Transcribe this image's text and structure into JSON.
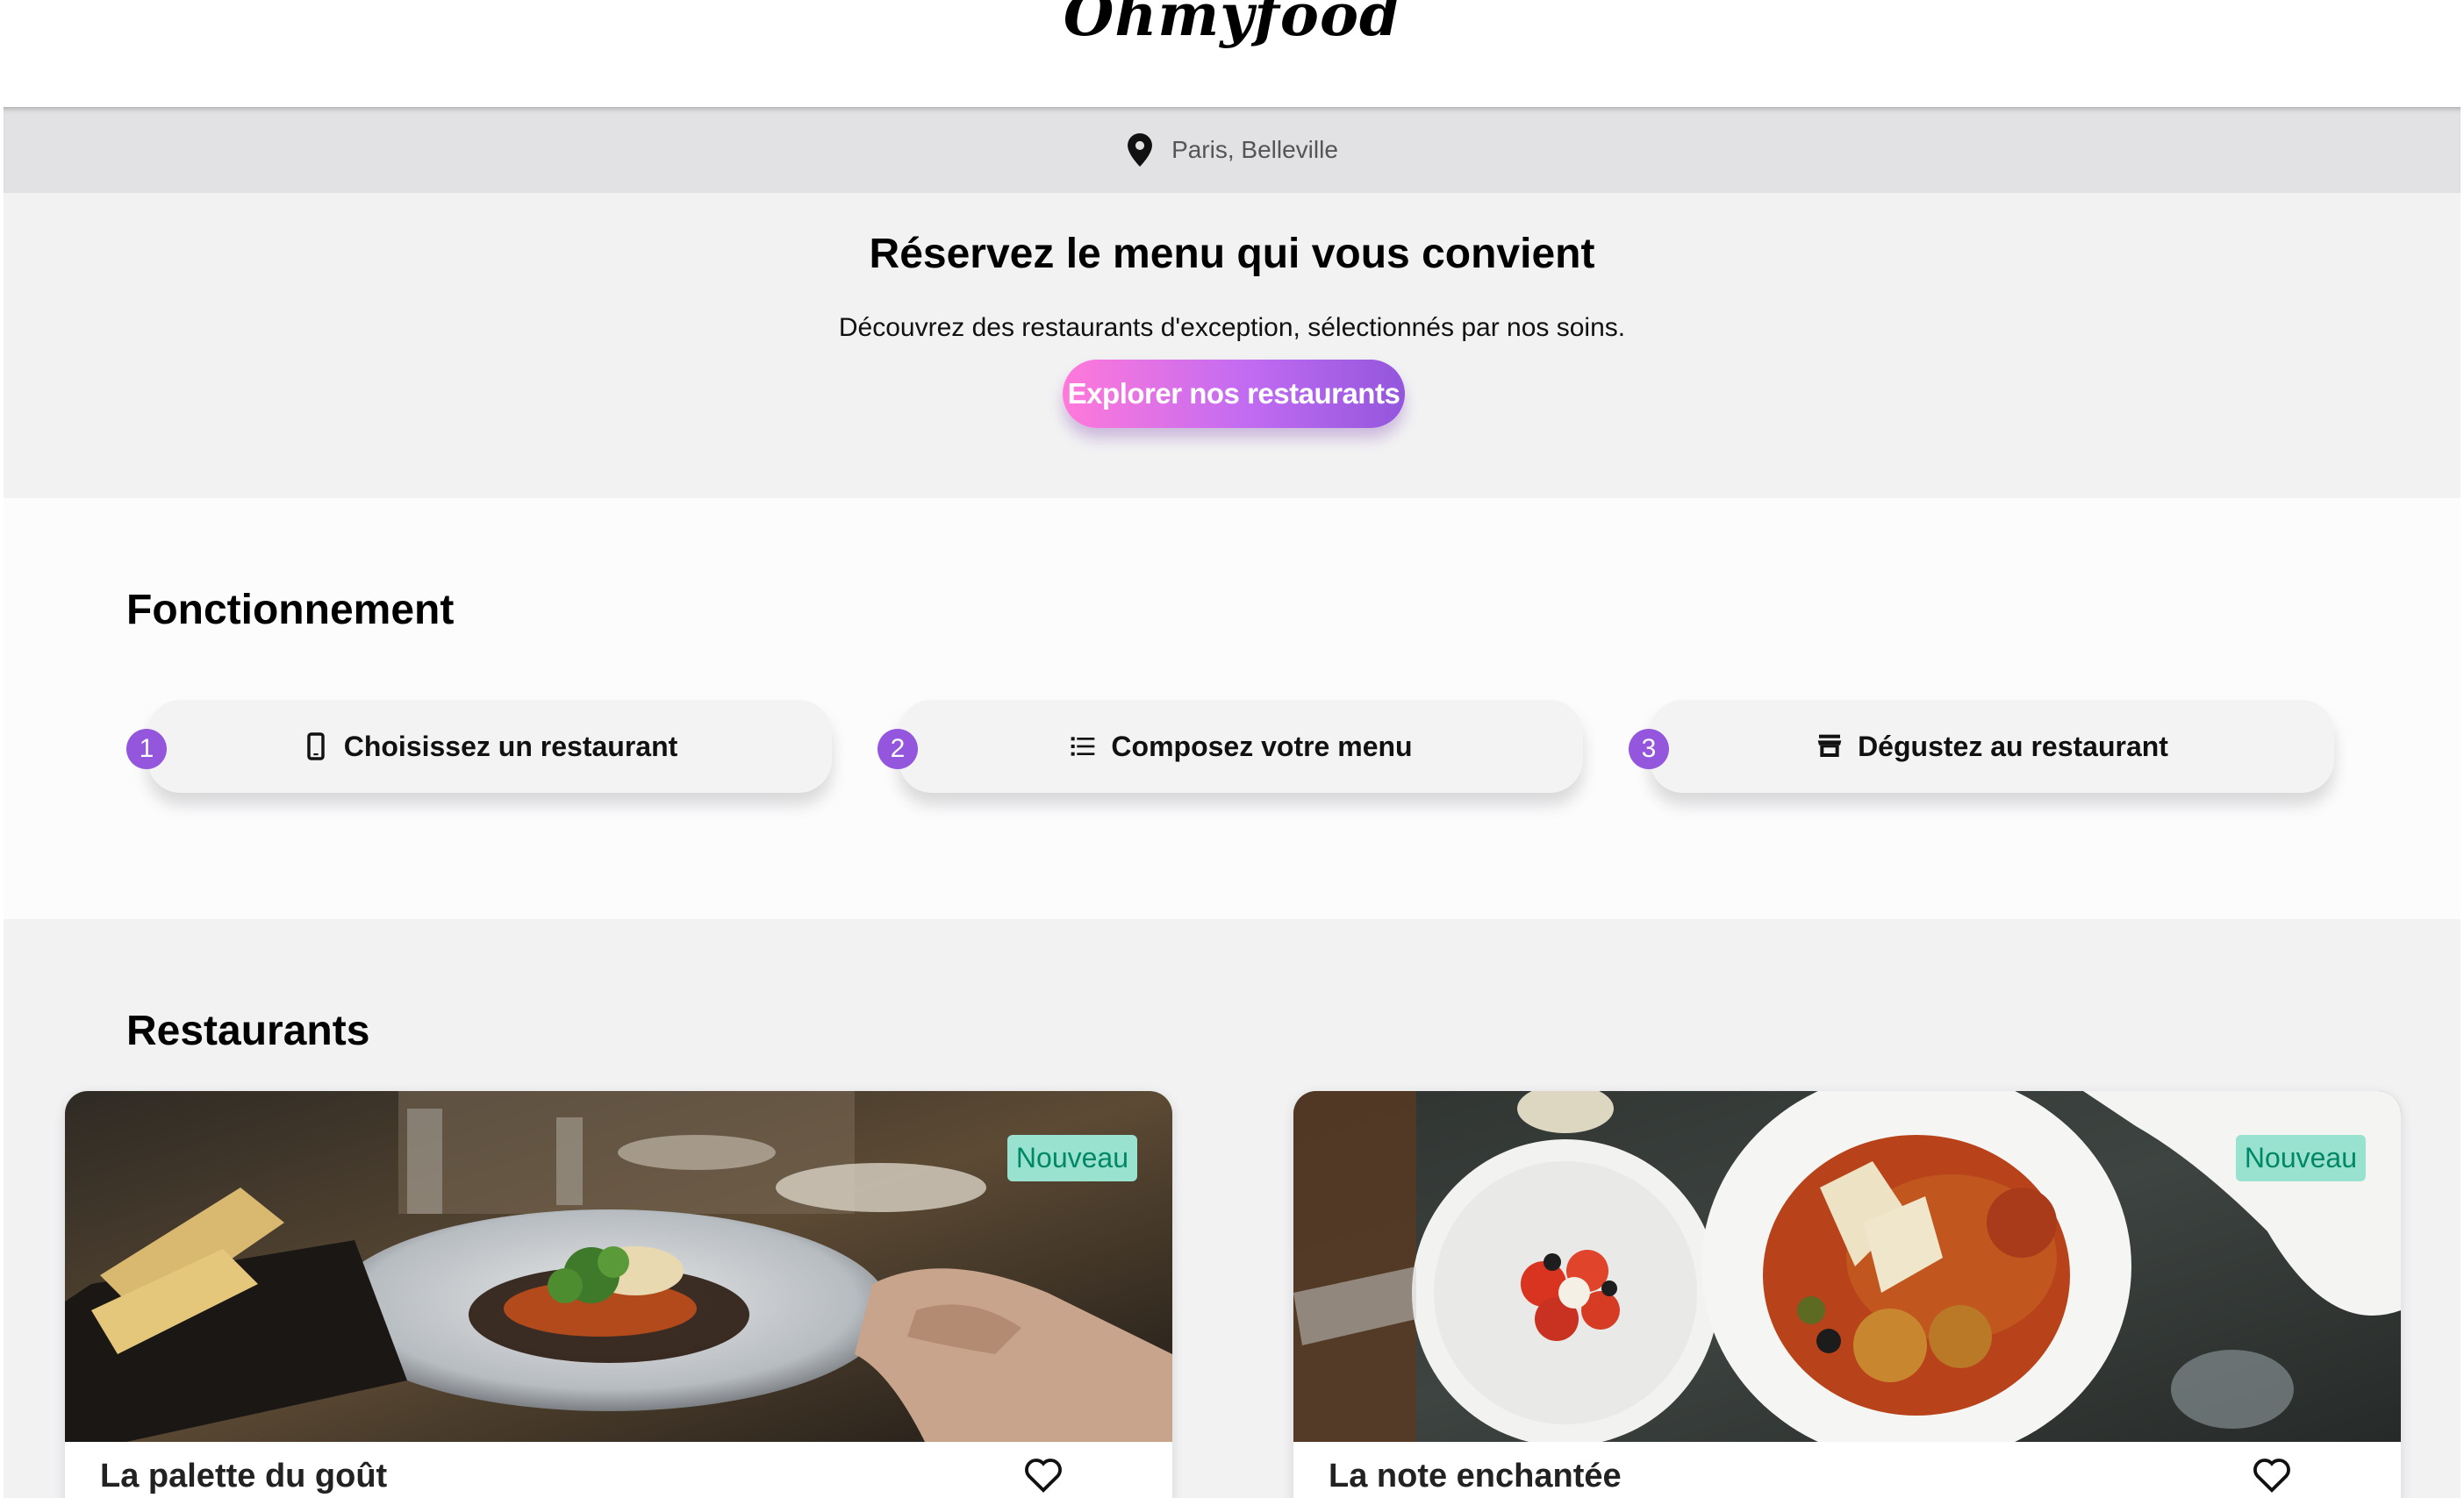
{
  "header": {
    "logo": "Ohmyfood"
  },
  "location": {
    "text": "Paris, Belleville",
    "icon": "location-pin-icon"
  },
  "hero": {
    "title": "Réservez le menu qui vous convient",
    "subtitle": "Découvrez des restaurants d'exception, sélectionnés par nos soins.",
    "cta_label": "Explorer nos restaurants"
  },
  "how": {
    "title": "Fonctionnement",
    "steps": [
      {
        "number": "1",
        "label": "Choisissez un restaurant",
        "icon": "mobile-phone-icon"
      },
      {
        "number": "2",
        "label": "Composez votre menu",
        "icon": "list-icon"
      },
      {
        "number": "3",
        "label": "Dégustez au restaurant",
        "icon": "store-icon"
      }
    ]
  },
  "restaurants": {
    "title": "Restaurants",
    "items": [
      {
        "name": "La palette du goût",
        "badge": "Nouveau"
      },
      {
        "name": "La note enchantée",
        "badge": "Nouveau"
      }
    ]
  },
  "colors": {
    "accent": "#9356dc",
    "accent_pink": "#ff79da",
    "badge_bg": "#99e2d0",
    "badge_text": "#008766"
  }
}
